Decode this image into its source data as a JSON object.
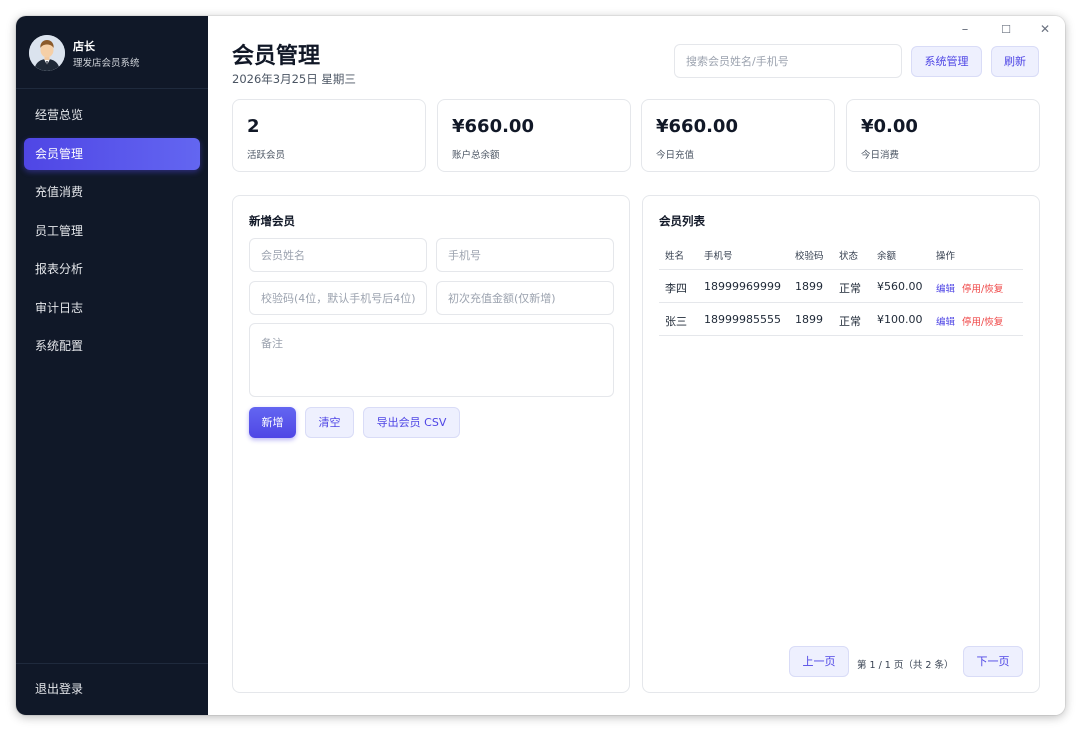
{
  "window": {
    "minimize": "–",
    "maximize": "☐",
    "close": "✕"
  },
  "sidebar": {
    "profile": {
      "name": "店长",
      "subtitle": "理发店会员系统"
    },
    "items": [
      {
        "label": "经营总览"
      },
      {
        "label": "会员管理",
        "active": true
      },
      {
        "label": "充值消费"
      },
      {
        "label": "员工管理"
      },
      {
        "label": "报表分析"
      },
      {
        "label": "审计日志"
      },
      {
        "label": "系统配置"
      }
    ],
    "logout_label": "退出登录"
  },
  "header": {
    "title": "会员管理",
    "date": "2026年3月25日 星期三",
    "search_placeholder": "搜索会员姓名/手机号",
    "system_button": "系统管理",
    "refresh_button": "刷新"
  },
  "stats": [
    {
      "value": "2",
      "label": "活跃会员"
    },
    {
      "value": "¥660.00",
      "label": "账户总余额"
    },
    {
      "value": "¥660.00",
      "label": "今日充值"
    },
    {
      "value": "¥0.00",
      "label": "今日消费"
    }
  ],
  "form": {
    "title": "新增会员",
    "name_placeholder": "会员姓名",
    "phone_placeholder": "手机号",
    "code_placeholder": "校验码(4位，默认手机号后4位)",
    "deposit_placeholder": "初次充值金额(仅新增)",
    "note_placeholder": "备注",
    "add_button": "新增",
    "clear_button": "清空",
    "export_button": "导出会员 CSV"
  },
  "member_list": {
    "title": "会员列表",
    "columns": {
      "name": "姓名",
      "phone": "手机号",
      "code": "校验码",
      "status": "状态",
      "balance": "余额",
      "actions": "操作"
    },
    "rows": [
      {
        "name": "李四",
        "phone": "18999969999",
        "code": "1899",
        "status": "正常",
        "balance": "¥560.00",
        "edit": "编辑",
        "toggle": "停用/恢复"
      },
      {
        "name": "张三",
        "phone": "18999985555",
        "code": "1899",
        "status": "正常",
        "balance": "¥100.00",
        "edit": "编辑",
        "toggle": "停用/恢复"
      }
    ],
    "pagination": {
      "prev": "上一页",
      "info": "第 1 / 1 页（共 2 条）",
      "next": "下一页"
    }
  },
  "colors": {
    "sidebar_bg": "#101828",
    "accent": "#4f46e5",
    "danger": "#ef4444"
  }
}
